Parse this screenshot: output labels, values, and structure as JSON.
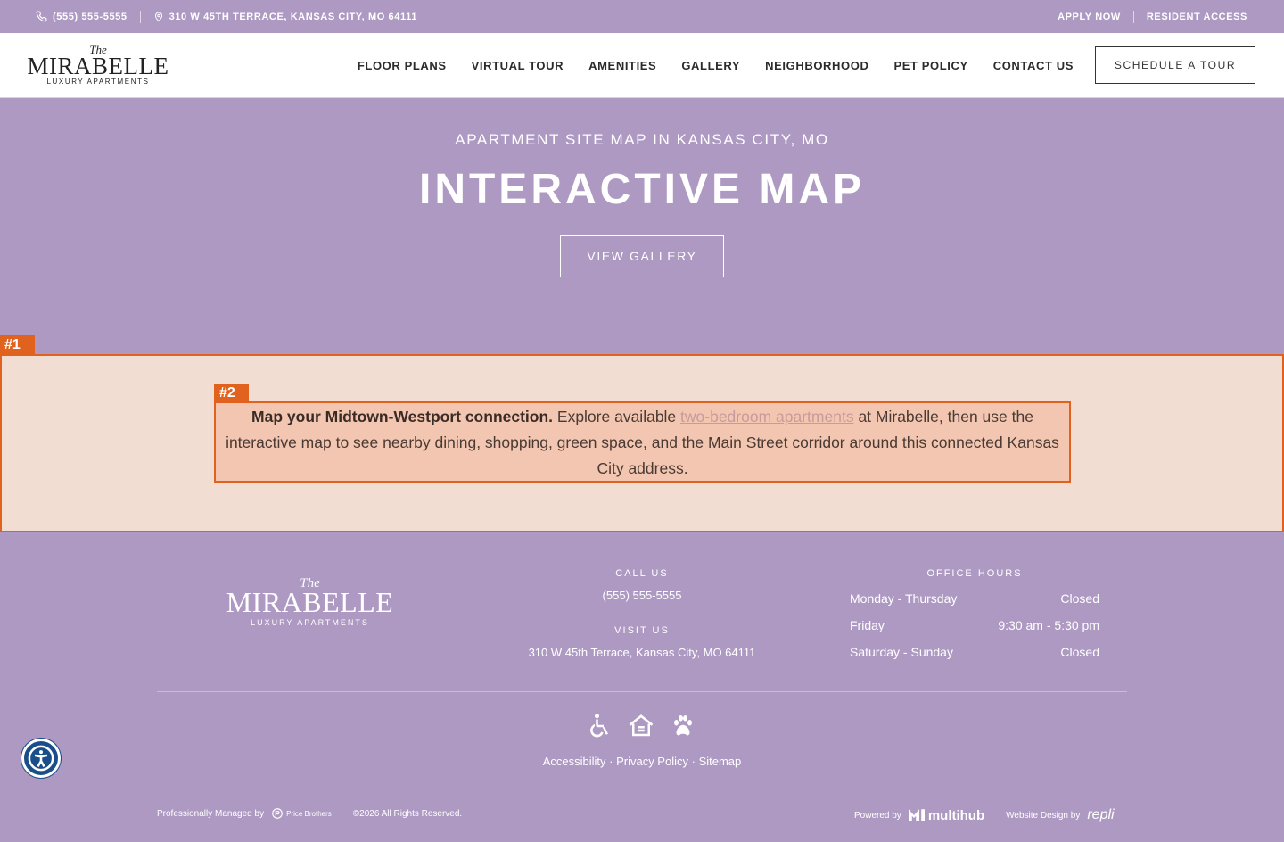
{
  "topbar": {
    "phone": "(555) 555-5555",
    "address": "310 W 45TH TERRACE, KANSAS CITY, MO 64111",
    "apply": "APPLY NOW",
    "resident": "RESIDENT ACCESS"
  },
  "logo": {
    "the": "The",
    "name": "MIRABELLE",
    "sub": "LUXURY APARTMENTS"
  },
  "nav": {
    "items": [
      "FLOOR PLANS",
      "VIRTUAL TOUR",
      "AMENITIES",
      "GALLERY",
      "NEIGHBORHOOD",
      "PET POLICY",
      "CONTACT US"
    ],
    "cta": "SCHEDULE A TOUR"
  },
  "hero": {
    "eyebrow": "APARTMENT SITE MAP IN KANSAS CITY, MO",
    "title": "INTERACTIVE MAP",
    "button": "VIEW GALLERY"
  },
  "annotations": {
    "section_label": "#1",
    "text_label": "#2"
  },
  "intro": {
    "lead": "Map your Midtown-Westport connection.",
    "before_link": " Explore available ",
    "link": "two-bedroom apartments",
    "after_link": " at Mirabelle, then use the interactive map to see nearby dining, shopping, green space, and the Main Street corridor around this connected Kansas City address."
  },
  "footer": {
    "call_heading": "CALL US",
    "phone": "(555) 555-5555",
    "visit_heading": "VISIT US",
    "address": "310 W 45th Terrace, Kansas City, MO 64111",
    "hours_heading": "OFFICE HOURS",
    "hours": [
      {
        "day": "Monday - Thursday",
        "time": "Closed"
      },
      {
        "day": "Friday",
        "time": "9:30 am - 5:30 pm"
      },
      {
        "day": "Saturday - Sunday",
        "time": "Closed"
      }
    ],
    "links": {
      "accessibility": "Accessibility",
      "privacy": "Privacy Policy",
      "sitemap": "Sitemap",
      "sep": " · "
    },
    "managed_by": "Professionally Managed by",
    "manager": "Price Brothers",
    "copyright": "©2026 All Rights Reserved.",
    "powered_by": "Powered by",
    "powered_brand": "multihub",
    "design_by": "Website Design by",
    "design_brand": "repli"
  },
  "colors": {
    "brand_purple": "#ae99c3",
    "highlight_orange": "#e0621e",
    "section_bg": "#f2ddd3",
    "a11y_blue": "#1a4e8a"
  }
}
